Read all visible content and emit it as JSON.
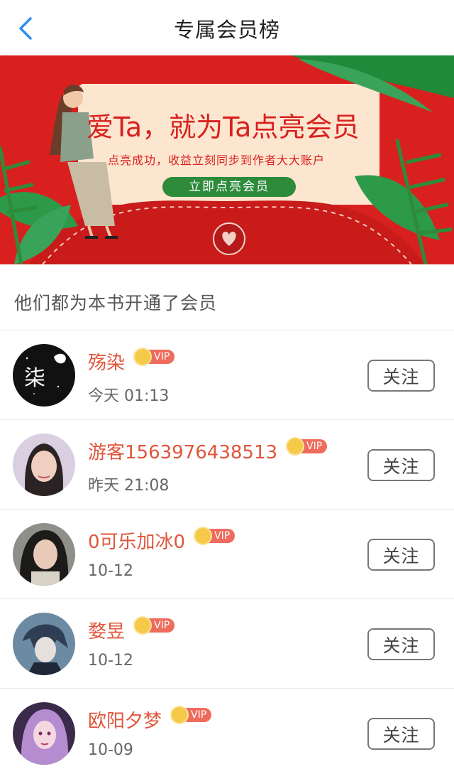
{
  "header": {
    "title": "专属会员榜",
    "back_icon": "chevron-left-icon",
    "accent": "#2f8cf1"
  },
  "banner": {
    "headline": "爱Ta，就为Ta点亮会员",
    "subline": "点亮成功，收益立刻同步到作者大大账户",
    "cta": "立即点亮会员",
    "colors": {
      "background": "#d8211f",
      "card": "#fde6cf",
      "cta": "#2e8b3a",
      "headline": "#d8211f"
    }
  },
  "section": {
    "title": "他们都为本书开通了会员"
  },
  "vip_label": "VIP",
  "follow_label": "关注",
  "members": [
    {
      "name": "殇染",
      "time": "今天 01:13",
      "avatar": "dark-text-avatar"
    },
    {
      "name": "游客1563976438513",
      "time": "昨天 21:08",
      "avatar": "girl-photo-avatar"
    },
    {
      "name": "0可乐加冰0",
      "time": "10-12",
      "avatar": "girl-photo-avatar"
    },
    {
      "name": "婺昱",
      "time": "10-12",
      "avatar": "anime-boy-avatar"
    },
    {
      "name": "欧阳夕梦",
      "time": "10-09",
      "avatar": "anime-girl-avatar"
    }
  ]
}
